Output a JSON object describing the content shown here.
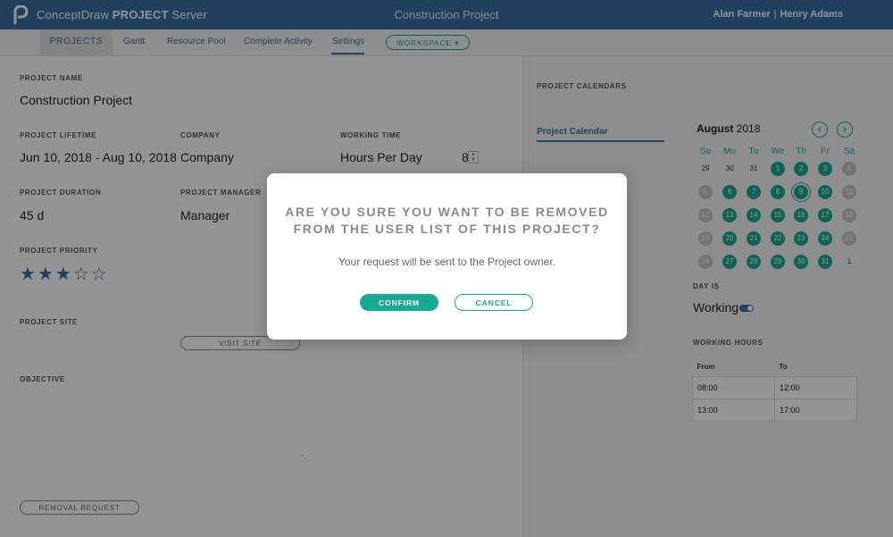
{
  "header": {
    "app_name_prefix": "ConceptDraw",
    "app_name_bold": "PROJECT",
    "app_name_suffix": "Server",
    "project_title": "Construction Project",
    "user_1": "Alan Farmer",
    "separator": "|",
    "user_2": "Henry Adams"
  },
  "nav": {
    "projects": "PROJECTS",
    "gantt": "Gantt",
    "resource_pool": "Resource Pool",
    "complete_activity": "Complete Activity",
    "settings": "Settings",
    "workspace": "WORKSPACE"
  },
  "form": {
    "project_name_label": "PROJECT NAME",
    "project_name": "Construction Project",
    "lifetime_label": "PROJECT LIFETIME",
    "lifetime": "Jun 10, 2018 - Aug 10, 2018",
    "company_label": "COMPANY",
    "company": "Company",
    "working_time_label": "WORKING TIME",
    "working_time": "Hours Per Day",
    "hours_per_day": "8",
    "duration_label": "PROJECT DURATION",
    "duration": "45 d",
    "manager_label": "PROJECT MANAGER",
    "manager": "Manager",
    "priority_label": "PROJECT PRIORITY",
    "priority_stars": 3,
    "priority_max": 5,
    "site_label": "PROJECT SITE",
    "visit_site": "VISIT SITE",
    "objective_label": "OBJECTIVE",
    "removal_request": "REMOVAL REQUEST"
  },
  "calendar": {
    "section_label": "PROJECT CALENDARS",
    "tab": "Project Calendar",
    "month": "August",
    "year": "2018",
    "prev_icon": "chevron-left-icon",
    "next_icon": "chevron-right-icon",
    "weekdays": [
      "Su",
      "Mo",
      "Tu",
      "We",
      "Th",
      "Fr",
      "Sa"
    ],
    "weeks": [
      [
        {
          "d": "29",
          "t": "plain"
        },
        {
          "d": "30",
          "t": "plain"
        },
        {
          "d": "31",
          "t": "plain"
        },
        {
          "d": "1",
          "t": "work"
        },
        {
          "d": "2",
          "t": "work"
        },
        {
          "d": "3",
          "t": "work"
        },
        {
          "d": "4",
          "t": "off"
        }
      ],
      [
        {
          "d": "5",
          "t": "off"
        },
        {
          "d": "6",
          "t": "work"
        },
        {
          "d": "7",
          "t": "work"
        },
        {
          "d": "8",
          "t": "work"
        },
        {
          "d": "9",
          "t": "sel"
        },
        {
          "d": "10",
          "t": "work"
        },
        {
          "d": "11",
          "t": "off"
        }
      ],
      [
        {
          "d": "12",
          "t": "off"
        },
        {
          "d": "13",
          "t": "work"
        },
        {
          "d": "14",
          "t": "work"
        },
        {
          "d": "15",
          "t": "work"
        },
        {
          "d": "16",
          "t": "work"
        },
        {
          "d": "17",
          "t": "work"
        },
        {
          "d": "18",
          "t": "off"
        }
      ],
      [
        {
          "d": "19",
          "t": "off"
        },
        {
          "d": "20",
          "t": "work"
        },
        {
          "d": "21",
          "t": "work"
        },
        {
          "d": "22",
          "t": "work"
        },
        {
          "d": "23",
          "t": "work"
        },
        {
          "d": "24",
          "t": "work"
        },
        {
          "d": "25",
          "t": "off"
        }
      ],
      [
        {
          "d": "26",
          "t": "off"
        },
        {
          "d": "27",
          "t": "work"
        },
        {
          "d": "28",
          "t": "work"
        },
        {
          "d": "29",
          "t": "work"
        },
        {
          "d": "30",
          "t": "work"
        },
        {
          "d": "31",
          "t": "work"
        },
        {
          "d": "1",
          "t": "plain"
        }
      ]
    ],
    "day_is_label": "DAY IS",
    "day_is": "Working",
    "working_hours_label": "WORKING HOURS",
    "hours_headers": [
      "From",
      "To"
    ],
    "hours_rows": [
      [
        "08:00",
        "12:00"
      ],
      [
        "13:00",
        "17:00"
      ]
    ]
  },
  "dialog": {
    "title_line_1": "ARE YOU SURE YOU WANT TO BE REMOVED",
    "title_line_2": "FROM THE USER LIST OF THIS PROJECT?",
    "message": "Your request will be sent to the Project owner.",
    "confirm": "CONFIRM",
    "cancel": "CANCEL"
  },
  "colors": {
    "brand_blue": "#3a6ea5",
    "accent_teal": "#1aaa94",
    "off_day_gray": "#c9c9c9"
  }
}
